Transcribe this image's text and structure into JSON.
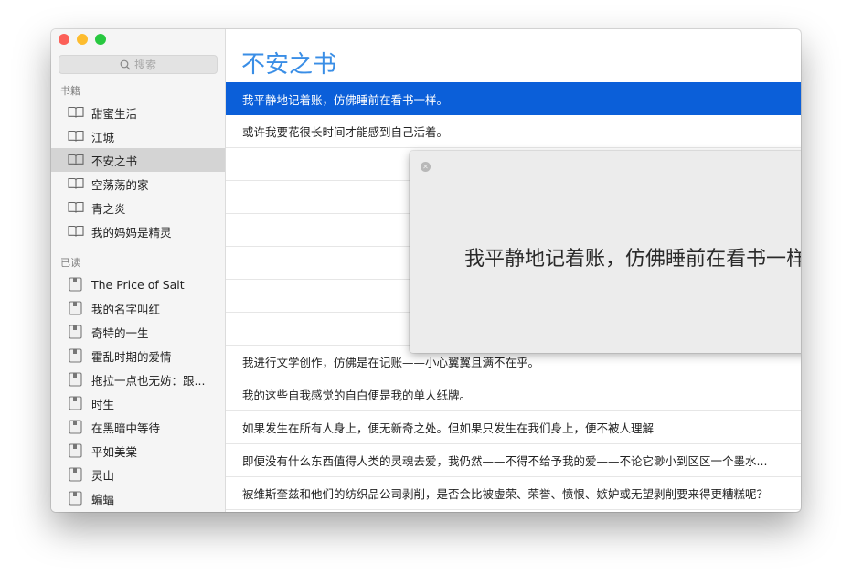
{
  "search": {
    "placeholder": "搜索"
  },
  "sidebar": {
    "books_header": "书籍",
    "books": [
      "甜蜜生活",
      "江城",
      "不安之书",
      "空荡荡的家",
      "青之炎",
      "我的妈妈是精灵"
    ],
    "read_header": "已读",
    "read": [
      "The Price of Salt",
      "我的名字叫红",
      "奇特的一生",
      "霍乱时期的爱情",
      "拖拉一点也无妨：跟...",
      "时生",
      "在黑暗中等待",
      "平如美棠",
      "灵山",
      "蝙蝠"
    ]
  },
  "main": {
    "title": "不安之书",
    "rows": [
      "我平静地记着账，仿佛睡前在看书一样。",
      "或许我要花很长时间才能感到自己活着。",
      "",
      "",
      "",
      "",
      "",
      "",
      "我进行文学创作，仿佛是在记账——小心翼翼且满不在乎。",
      "我的这些自我感觉的自白便是我的单人纸牌。",
      "如果发生在所有人身上，便无新奇之处。但如果只发生在我们身上，便不被人理解",
      "即便没有什么东西值得人类的灵魂去爱，我仍然——不得不给予我的爱——不论它渺小到区区一个墨水...",
      "被维斯奎兹和他们的纺织品公司剥削，是否会比被虚荣、荣誉、愤恨、嫉妒或无望剥削要来得更糟糕呢？"
    ]
  },
  "popover": {
    "text": "我平静地记着账，仿佛睡前在看书一样。"
  },
  "colors": {
    "accent": "#3a8ee6",
    "selection": "#0b5fd9"
  }
}
